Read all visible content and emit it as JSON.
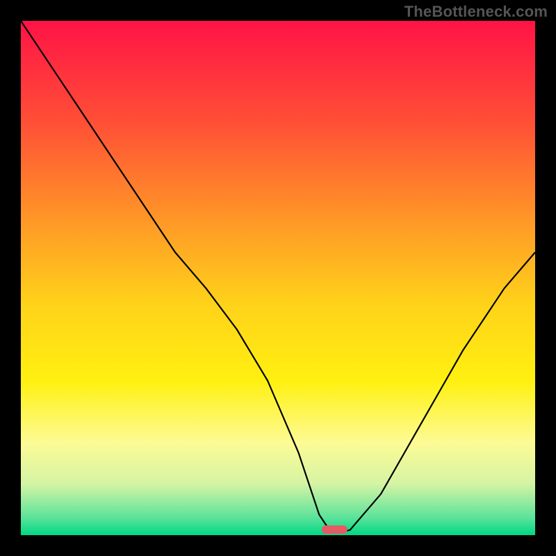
{
  "watermark": "TheBottleneck.com",
  "chart_data": {
    "type": "line",
    "title": "",
    "xlabel": "",
    "ylabel": "",
    "xlim": [
      0,
      100
    ],
    "ylim": [
      0,
      100
    ],
    "grid": false,
    "legend": false,
    "background_gradient": {
      "stops": [
        {
          "offset": 0.0,
          "color": "#ff1346"
        },
        {
          "offset": 0.2,
          "color": "#ff5036"
        },
        {
          "offset": 0.4,
          "color": "#ff9c26"
        },
        {
          "offset": 0.55,
          "color": "#ffd21a"
        },
        {
          "offset": 0.7,
          "color": "#fff010"
        },
        {
          "offset": 0.82,
          "color": "#fdfb95"
        },
        {
          "offset": 0.9,
          "color": "#d5f4a4"
        },
        {
          "offset": 0.965,
          "color": "#5de39a"
        },
        {
          "offset": 1.0,
          "color": "#00d885"
        }
      ]
    },
    "series": [
      {
        "name": "bottleneck-curve",
        "x": [
          0,
          8,
          16,
          24,
          30,
          36,
          42,
          48,
          54,
          58,
          60,
          62,
          64,
          70,
          78,
          86,
          94,
          100
        ],
        "y": [
          100,
          88,
          76,
          64,
          55,
          48,
          40,
          30,
          16,
          4,
          1,
          0.5,
          1,
          8,
          22,
          36,
          48,
          55
        ]
      }
    ],
    "marker": {
      "name": "optimal-region-marker",
      "x_center": 61,
      "y": 0,
      "width": 5,
      "color": "#e55a63"
    }
  }
}
